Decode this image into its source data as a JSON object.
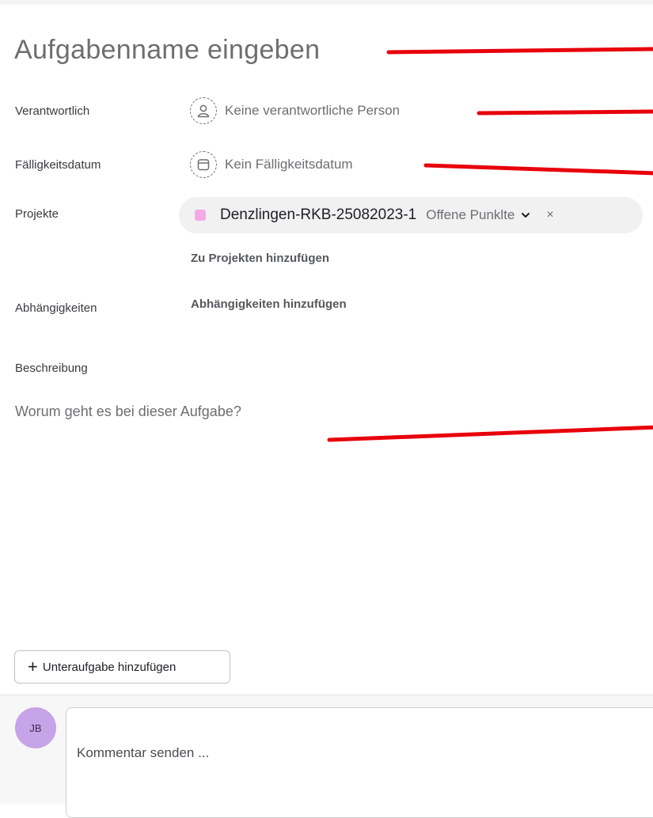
{
  "task": {
    "title_placeholder": "Aufgabenname eingeben",
    "fields": {
      "assignee": {
        "label": "Verantwortlich",
        "value": "Keine verantwortliche Person",
        "icon": "person-icon"
      },
      "due_date": {
        "label": "Fälligkeitsdatum",
        "value": "Kein Fälligkeitsdatum",
        "icon": "calendar-icon"
      },
      "projects": {
        "label": "Projekte",
        "project_name": "Denzlingen-RKB-25082023-1",
        "section": "Offene Punklte",
        "project_color": "#f5a9e4",
        "remove_symbol": "×",
        "add_link": "Zu Projekten hinzufügen"
      },
      "dependencies": {
        "label": "Abhängigkeiten",
        "add_link": "Abhängigkeiten hinzufügen"
      },
      "description": {
        "label": "Beschreibung",
        "placeholder": "Worum geht es bei dieser Aufgabe?"
      }
    },
    "subtask_button": {
      "plus": "+",
      "label": "Unteraufgabe hinzufügen"
    }
  },
  "comment_bar": {
    "avatar_initials": "JB",
    "avatar_color": "#c7a3e8",
    "placeholder": "Kommentar senden ..."
  },
  "annotation_color": "#e8000b"
}
